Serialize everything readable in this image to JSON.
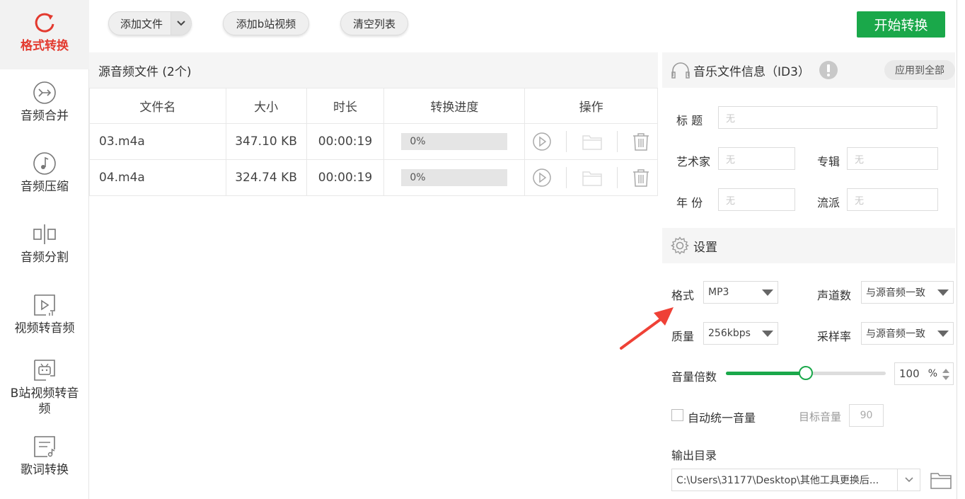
{
  "sidebar": {
    "items": [
      {
        "label": "格式转换",
        "icon": "refresh-icon",
        "active": true
      },
      {
        "label": "音频合并",
        "icon": "merge-icon"
      },
      {
        "label": "音频压缩",
        "icon": "music-note-icon"
      },
      {
        "label": "音频分割",
        "icon": "split-icon"
      },
      {
        "label": "视频转音频",
        "icon": "video-play-icon"
      },
      {
        "label": "B站视频转音",
        "label2": "频",
        "icon": "bilibili-tv-icon"
      },
      {
        "label": "歌词转换",
        "icon": "lyrics-file-icon"
      }
    ]
  },
  "toolbar": {
    "add_file": "添加文件",
    "add_bilibili": "添加b站视频",
    "clear_list": "清空列表",
    "start": "开始转换"
  },
  "file_list": {
    "title": "源音频文件 (2个)",
    "columns": [
      "文件名",
      "大小",
      "时长",
      "转换进度",
      "操作"
    ],
    "rows": [
      {
        "name": "03.m4a",
        "size": "347.10 KB",
        "duration": "00:00:19",
        "progress": "0%"
      },
      {
        "name": "04.m4a",
        "size": "324.74 KB",
        "duration": "00:00:19",
        "progress": "0%"
      }
    ]
  },
  "id3": {
    "title": "音乐文件信息（ID3）",
    "apply_all": "应用到全部",
    "fields": {
      "title_label": "标  题",
      "artist_label": "艺术家",
      "album_label": "专辑",
      "year_label": "年  份",
      "genre_label": "流派",
      "placeholder": "无"
    }
  },
  "settings": {
    "title": "设置",
    "format_label": "格式",
    "format_value": "MP3",
    "channels_label": "声道数",
    "channels_value": "与源音频一致",
    "quality_label": "质量",
    "quality_value": "256kbps",
    "samplerate_label": "采样率",
    "samplerate_value": "与源音频一致",
    "volume_label": "音量倍数",
    "volume_value": "100",
    "volume_unit": "%",
    "volume_fraction": 0.5,
    "auto_volume_label": "自动统一音量",
    "target_volume_label": "目标音量",
    "target_volume_value": "90",
    "output_label": "输出目录",
    "output_path": "C:\\Users\\31177\\Desktop\\其他工具更换后..."
  },
  "colors": {
    "accent": "#1aa84a",
    "active": "#e33a2f",
    "annotation_arrow": "#ef4136"
  }
}
